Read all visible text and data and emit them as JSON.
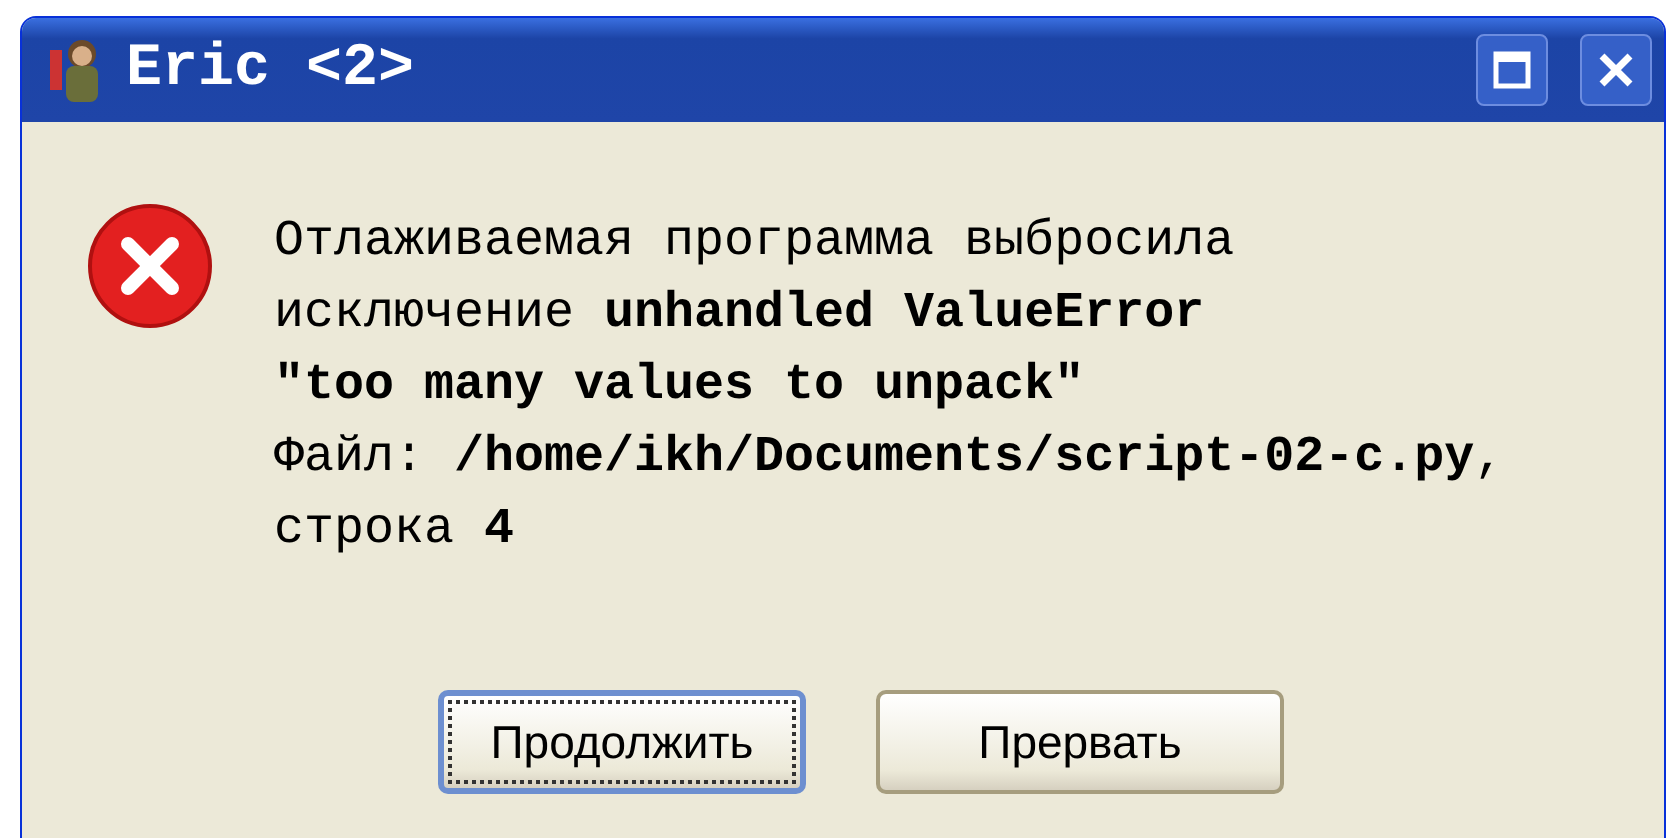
{
  "window": {
    "title": "Eric <2>"
  },
  "message": {
    "lines": [
      "Отлаживаемая программа выбросила",
      "исключение **unhandled ValueError**",
      "**\"too many values to unpack\"**",
      "Файл: **/home/ikh/Documents/script-02-c.py**,",
      "строка **4**"
    ]
  },
  "buttons": [
    {
      "label": "Продолжить",
      "focused": true
    },
    {
      "label": "Прервать",
      "focused": false
    }
  ]
}
